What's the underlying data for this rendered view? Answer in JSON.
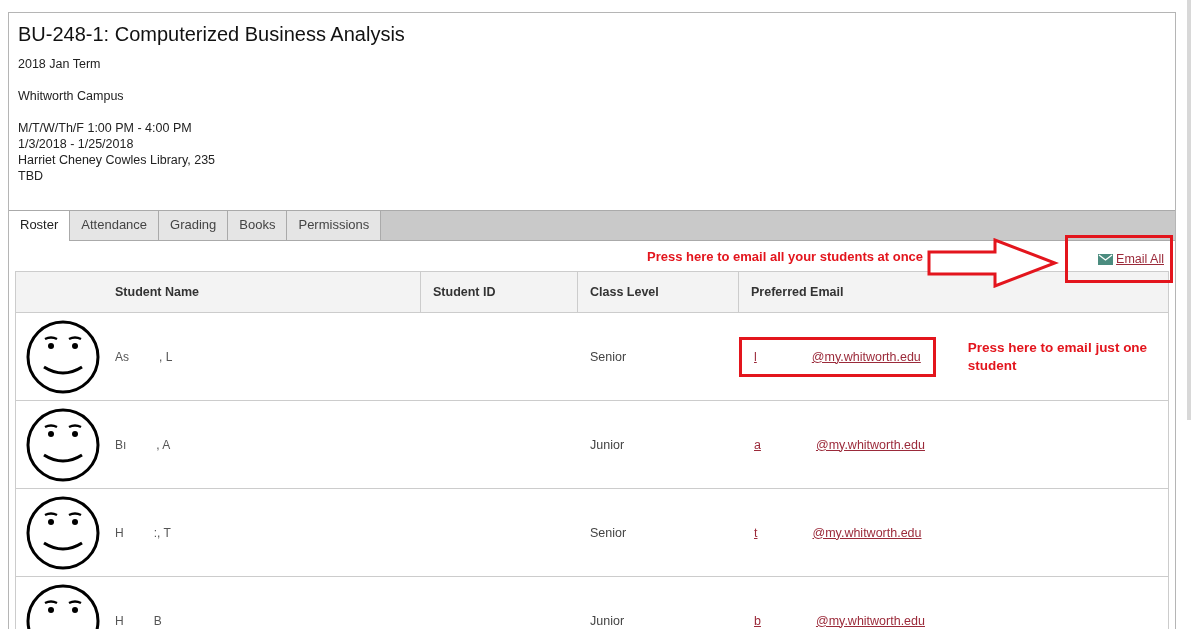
{
  "course": {
    "title": "BU-248-1: Computerized Business Analysis",
    "term": "2018 Jan Term",
    "campus": "Whitworth Campus",
    "schedule": [
      "M/T/W/Th/F 1:00 PM - 4:00 PM",
      "1/3/2018 - 1/25/2018",
      "Harriet Cheney Cowles Library, 235",
      "TBD"
    ]
  },
  "tabs": [
    {
      "label": "Roster",
      "selected": true
    },
    {
      "label": "Attendance",
      "selected": false
    },
    {
      "label": "Grading",
      "selected": false
    },
    {
      "label": "Books",
      "selected": false
    },
    {
      "label": "Permissions",
      "selected": false
    }
  ],
  "email_all": {
    "label": " Email All",
    "highlighted": true
  },
  "annotations": [
    {
      "text": "Press here to email all your students at once",
      "kind": "arrow"
    },
    {
      "text": "Press here to email just one student",
      "kind": "plain"
    }
  ],
  "table": {
    "columns": [
      "Student Name",
      "Student ID",
      "Class Level",
      "Preferred Email"
    ],
    "rows": [
      {
        "name_start": "As",
        "name_end": ", L",
        "class_level": "Senior",
        "email_start": "l",
        "email_end": "@my.whitworth.edu",
        "highlighted": true
      },
      {
        "name_start": "Bı",
        "name_end": ", A",
        "class_level": "Junior",
        "email_start": "a",
        "email_end": "@my.whitworth.edu",
        "highlighted": false
      },
      {
        "name_start": "H",
        "name_end": ":, T",
        "class_level": "Senior",
        "email_start": "t",
        "email_end": "@my.whitworth.edu",
        "highlighted": false
      },
      {
        "name_start": "H",
        "name_end": "B",
        "class_level": "Junior",
        "email_start": "b",
        "email_end": "@my.whitworth.edu",
        "highlighted": false
      }
    ]
  }
}
